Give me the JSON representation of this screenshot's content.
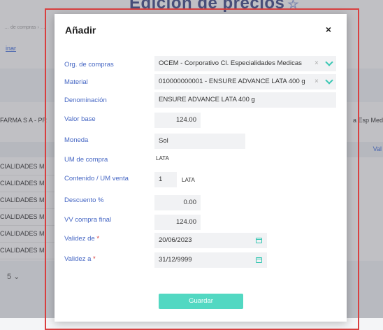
{
  "background": {
    "page_title": "Edición de precios",
    "breadcrumb": "… de compras › …",
    "link_text": "inar",
    "provider_text": "FARMA S A - PR",
    "right_text": "a Esp Med",
    "header_right": "Val",
    "rows": [
      "CIALIDADES M",
      "CIALIDADES M",
      "CIALIDADES M",
      "CIALIDADES M",
      "CIALIDADES M",
      "CIALIDADES M"
    ],
    "pager": "5 ⌄"
  },
  "modal": {
    "title": "Añadir",
    "close": "×",
    "labels": {
      "org": "Org. de compras",
      "material": "Material",
      "denominacion": "Denominación",
      "valor_base": "Valor base",
      "moneda": "Moneda",
      "um_compra": "UM de compra",
      "contenido": "Contenido / UM venta",
      "descuento": "Descuento %",
      "vv_compra": "VV compra final",
      "validez_de": "Validez de ",
      "validez_a": "Validez a ",
      "required_mark": "*"
    },
    "values": {
      "org": "OCEM - Corporativo Cl. Especialidades Medicas",
      "material": "010000000001 - ENSURE ADVANCE LATA 400 g",
      "denominacion": "ENSURE ADVANCE  LATA 400 g",
      "valor_base": "124.00",
      "moneda": "Sol",
      "um_compra": "LATA",
      "contenido_qty": "1",
      "contenido_unit": "LATA",
      "descuento": "0.00",
      "vv_compra": "124.00",
      "validez_de": "20/06/2023",
      "validez_a": "31/12/9999"
    },
    "clear_symbol": "×",
    "save_label": "Guardar"
  },
  "colors": {
    "label": "#4667c4",
    "accent": "#52d8c2",
    "required": "#d43a3a",
    "frame": "#d94040"
  }
}
